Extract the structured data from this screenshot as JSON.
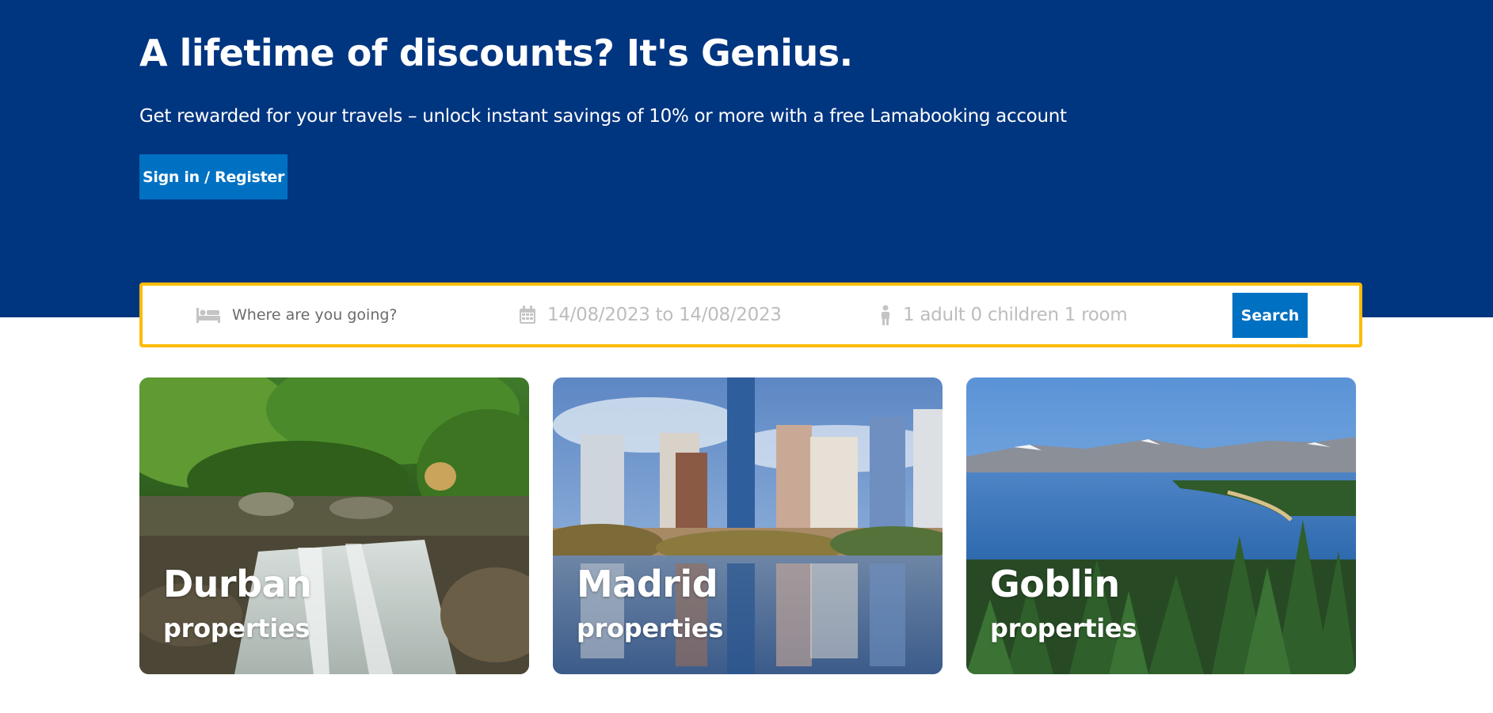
{
  "hero": {
    "title": "A lifetime of discounts? It's Genius.",
    "subtitle": "Get rewarded for your travels – unlock instant savings of 10% or more with a free Lamabooking account",
    "signin_label": "Sign in / Register"
  },
  "search": {
    "destination_placeholder": "Where are you going?",
    "dates": "14/08/2023 to 14/08/2023",
    "guests": "1 adult 0 children 1 room",
    "button_label": "Search",
    "icons": {
      "destination": "bed-icon",
      "dates": "calendar-icon",
      "guests": "person-icon"
    }
  },
  "destinations": [
    {
      "city": "Durban",
      "subtitle": "properties",
      "image": "waterfall-forest"
    },
    {
      "city": "Madrid",
      "subtitle": "properties",
      "image": "city-skyline-reflection"
    },
    {
      "city": "Goblin",
      "subtitle": "properties",
      "image": "lake-mountains-pines"
    }
  ],
  "colors": {
    "hero_bg": "#003580",
    "button_bg": "#0071c2",
    "search_border": "#febb02",
    "text_white": "#ffffff"
  }
}
